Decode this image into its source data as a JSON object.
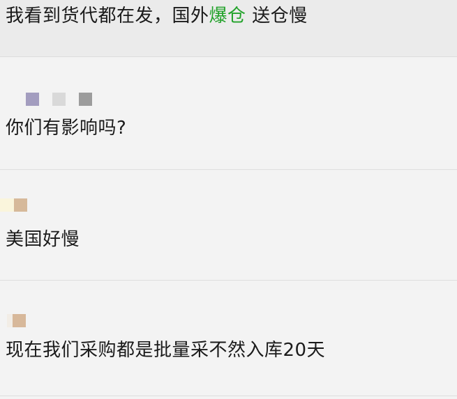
{
  "messages": [
    {
      "text_before": "我看到货代都在发，国外",
      "highlight": "爆仓",
      "text_after": " 送仓慢",
      "highlight_color": "#22a22a"
    },
    {
      "avatar_colors": [
        "#a39dbf",
        "#d9d9d9",
        "#9c9c9c"
      ],
      "text": "你们有影响吗?"
    },
    {
      "avatar_colors": [
        "#faf5dc",
        "#d6b99a"
      ],
      "text": "美国好慢"
    },
    {
      "avatar_colors": [
        "#f2ede6",
        "#d7b89a"
      ],
      "text": "现在我们采购都是批量采不然入库20天"
    }
  ]
}
